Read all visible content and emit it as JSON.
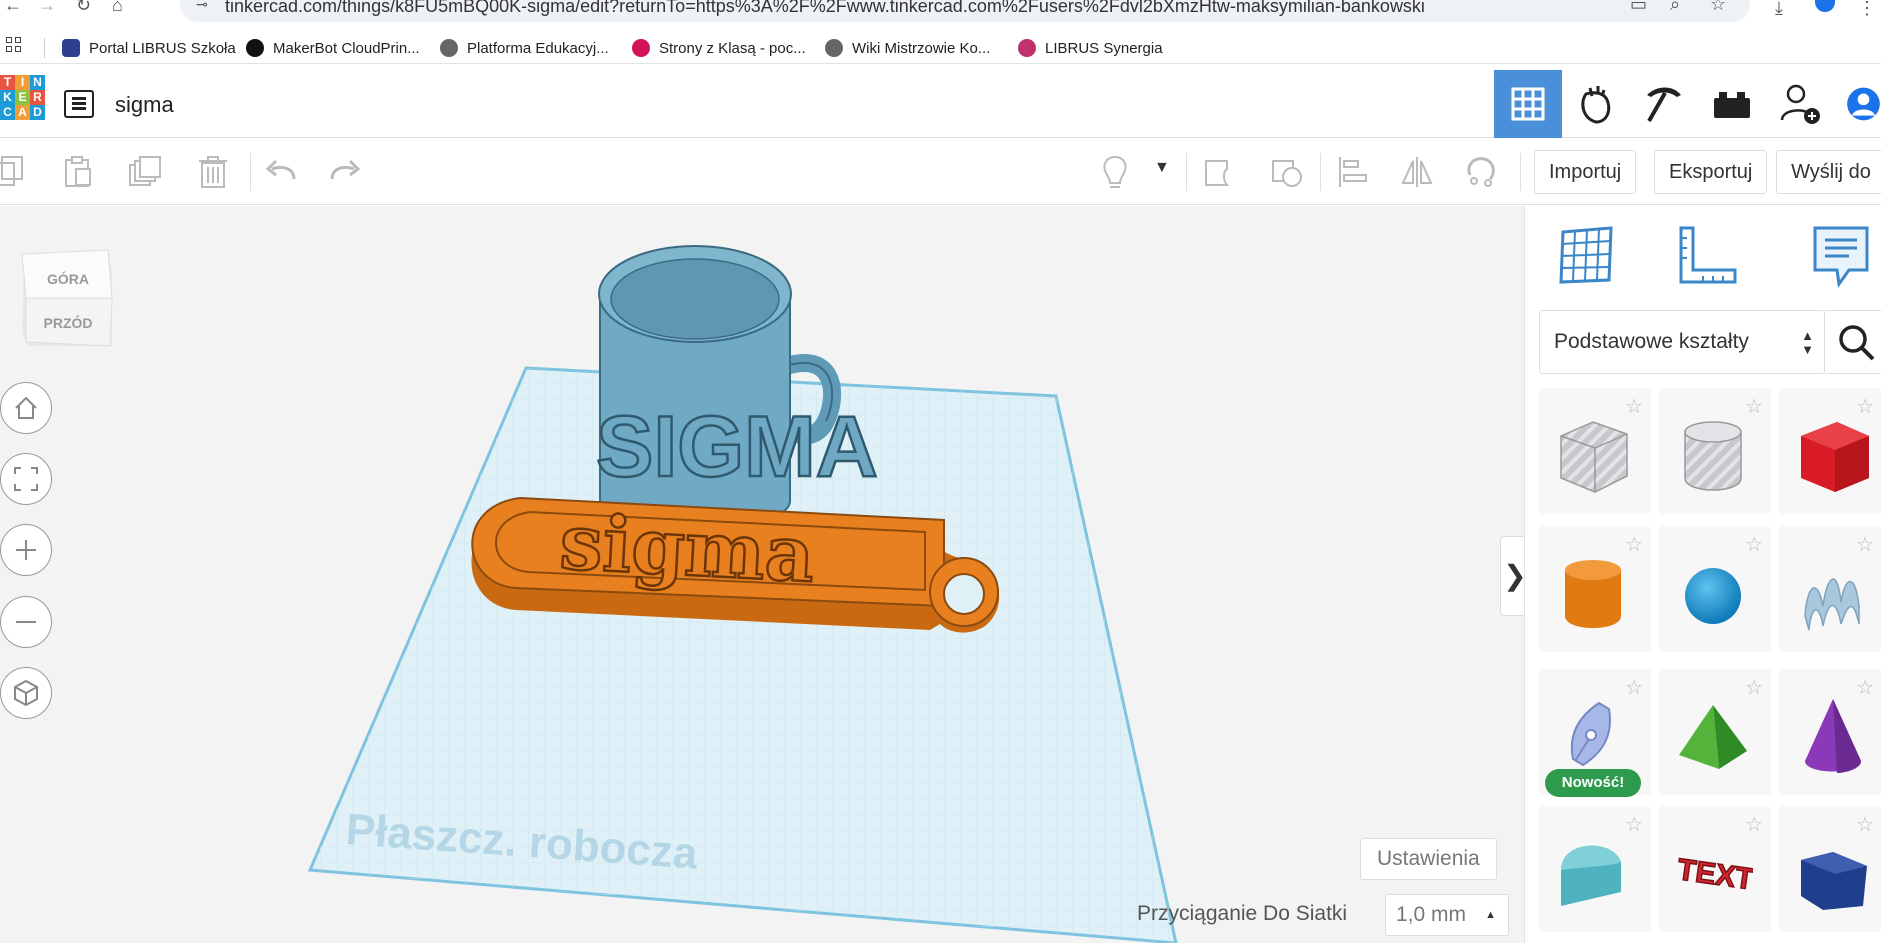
{
  "browser": {
    "url": "tinkercad.com/things/k8FU5mBQ00K-sigma/edit?returnTo=https%3A%2F%2Fwww.tinkercad.com%2Fusers%2Fdvl2bXmzHtw-maksymilian-bankowski",
    "bookmarks": [
      {
        "label": "Portal LIBRUS Szkoła",
        "color": "#2d3f8f"
      },
      {
        "label": "MakerBot CloudPrin...",
        "color": "#111111"
      },
      {
        "label": "Platforma Edukacyj...",
        "color": "#555555"
      },
      {
        "label": "Strony z Klasą - poc...",
        "color": "#d4145a"
      },
      {
        "label": "Wiki Mistrzowie Ko...",
        "color": "#555555"
      },
      {
        "label": "LIBRUS Synergia",
        "color": "#c0306a"
      }
    ]
  },
  "header": {
    "logo_letters": [
      "T",
      "I",
      "N",
      "K",
      "E",
      "R",
      "C",
      "A",
      "D"
    ],
    "title": "sigma"
  },
  "toolbar": {
    "import_label": "Importuj",
    "export_label": "Eksportuj",
    "send_label": "Wyślij do"
  },
  "viewport": {
    "viewcube_top": "GÓRA",
    "viewcube_front": "PRZÓD",
    "workplane_label": "Płaszcz. robocza",
    "mug_text": "SIGMA",
    "keychain_text": "sigma",
    "settings_label": "Ustawienia",
    "snap_label": "Przyciąganie Do Siatki",
    "snap_value": "1,0 mm"
  },
  "panel": {
    "shape_category": "Podstawowe kształty",
    "new_badge": "Nowość!",
    "text_shape_label": "TEXT"
  },
  "colors": {
    "accent": "#4a90d9",
    "mug": "#6fa9c4",
    "keychain": "#e9801f",
    "grid_plane": "#dff0f7"
  }
}
